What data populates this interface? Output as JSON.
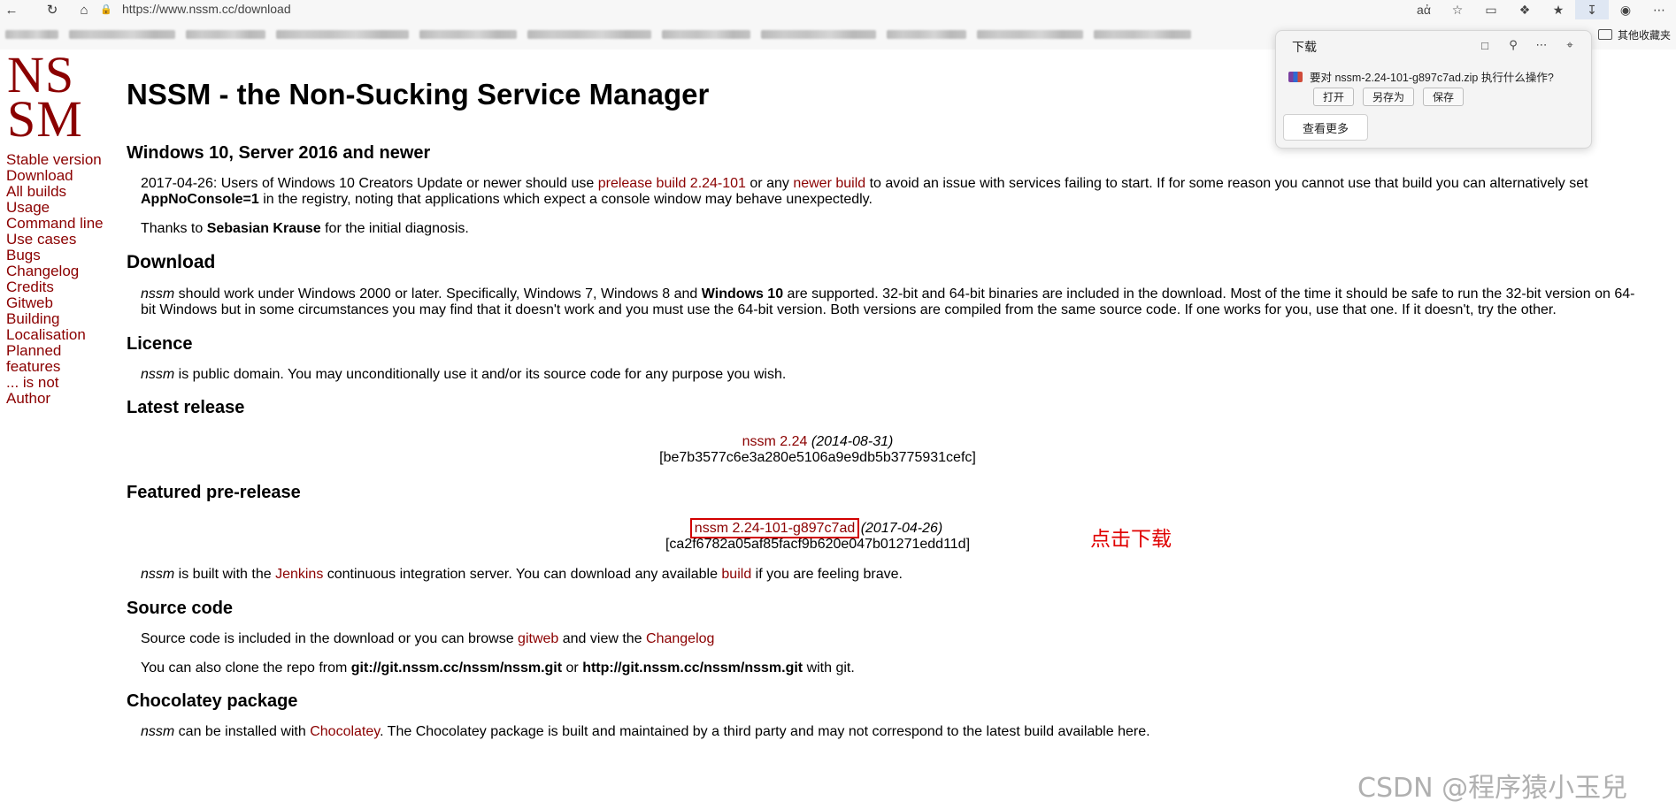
{
  "browser": {
    "url": "https://www.nssm.cc/download",
    "bookmarks_other": "其他收藏夹"
  },
  "logo": {
    "line1": "NS",
    "line2": "SM"
  },
  "sidebar": {
    "items": [
      "Stable version",
      "Download",
      "All builds",
      "Usage",
      "Command line",
      "Use cases",
      "Bugs",
      "Changelog",
      "Credits",
      "Gitweb",
      "Building",
      "Localisation",
      "Planned features",
      "... is not",
      "Author"
    ]
  },
  "page": {
    "title": "NSSM - the Non-Sucking Service Manager",
    "win10": {
      "heading": "Windows 10, Server 2016 and newer",
      "p1_a": "2017-04-26: Users of Windows 10 Creators Update or newer should use ",
      "p1_link1": "prelease build 2.24-101",
      "p1_b": " or any ",
      "p1_link2": "newer build",
      "p1_c": " to avoid an issue with services failing to start. If for some reason you cannot use that build you can alternatively set ",
      "p1_bold": "AppNoConsole=1",
      "p1_d": " in the registry, noting that applications which expect a console window may behave unexpectedly.",
      "p2_a": "Thanks to ",
      "p2_bold": "Sebasian Krause",
      "p2_b": " for the initial diagnosis."
    },
    "download": {
      "heading": "Download",
      "em": "nssm",
      "p_a": " should work under Windows 2000 or later. Specifically, Windows 7, Windows 8 and ",
      "p_bold": "Windows 10",
      "p_b": " are supported. 32-bit and 64-bit binaries are included in the download. Most of the time it should be safe to run the 32-bit version on 64-bit Windows but in some circumstances you may find that it doesn't work and you must use the 64-bit version. Both versions are compiled from the same source code. If one works for you, use that one. If it doesn't, try the other."
    },
    "licence": {
      "heading": "Licence",
      "em": "nssm",
      "p": " is public domain. You may unconditionally use it and/or its source code for any purpose you wish."
    },
    "latest": {
      "heading": "Latest release",
      "link": "nssm 2.24",
      "date": "(2014-08-31)",
      "hash": "[be7b3577c6e3a280e5106a9e9db5b3775931cefc]"
    },
    "featured": {
      "heading": "Featured pre-release",
      "link": "nssm 2.24-101-g897c7ad",
      "date": "(2017-04-26)",
      "hash": "[ca2f6782a05af85facf9b620e047b01271edd11d]",
      "em": "nssm",
      "p_a": " is built with the ",
      "p_link1": "Jenkins",
      "p_b": " continuous integration server. You can download any available ",
      "p_link2": "build",
      "p_c": " if you are feeling brave.",
      "annotation": "点击下载"
    },
    "source": {
      "heading": "Source code",
      "p1_a": "Source code is included in the download or you can browse ",
      "p1_link1": "gitweb",
      "p1_b": " and view the ",
      "p1_link2": "Changelog",
      "p2_a": "You can also clone the repo from ",
      "p2_bold1": "git://git.nssm.cc/nssm/nssm.git",
      "p2_b": " or ",
      "p2_bold2": "http://git.nssm.cc/nssm/nssm.git",
      "p2_c": " with git."
    },
    "chocolatey": {
      "heading": "Chocolatey package",
      "em": "nssm",
      "p_a": " can be installed with ",
      "p_link": "Chocolatey",
      "p_b": ". The Chocolatey package is built and maintained by a third party and may not correspond to the latest build available here."
    }
  },
  "download_popup": {
    "title": "下载",
    "message": "要对 nssm-2.24-101-g897c7ad.zip 执行什么操作?",
    "btn_open": "打开",
    "btn_save_as": "另存为",
    "btn_save": "保存",
    "btn_more": "查看更多"
  },
  "watermark": "CSDN @程序猿小玉兒"
}
